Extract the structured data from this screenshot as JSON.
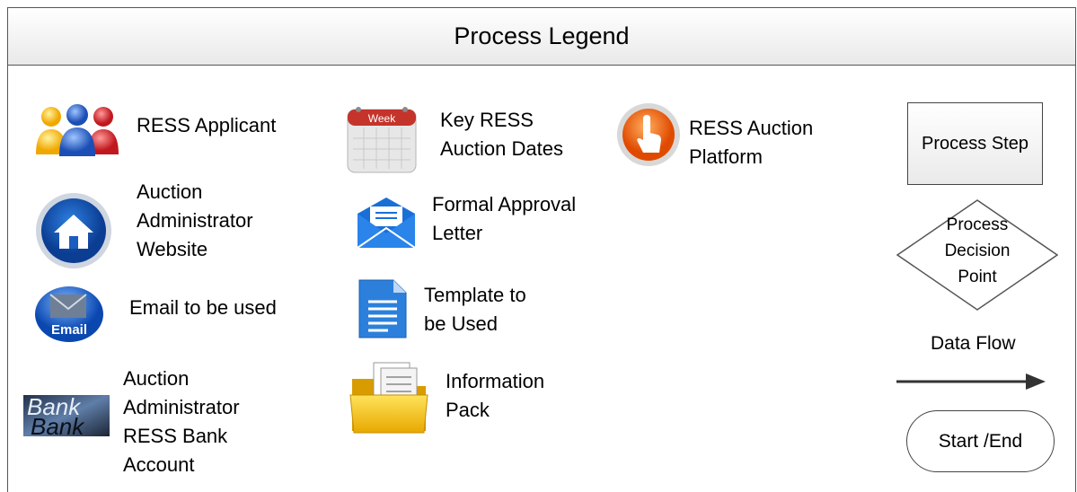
{
  "header": {
    "title": "Process Legend"
  },
  "items": {
    "applicant": "RESS Applicant",
    "website": [
      "Auction",
      "Administrator",
      "Website"
    ],
    "email": "Email to be used",
    "bank": [
      "Auction",
      "Administrator",
      "RESS Bank",
      "Account"
    ],
    "bank_icon_text": [
      "Bank",
      "Bank"
    ],
    "dates": [
      "Key RESS",
      "Auction Dates"
    ],
    "calendar_icon_text": "Week",
    "approval": [
      "Formal Approval",
      "Letter"
    ],
    "template": [
      "Template to",
      "be Used"
    ],
    "pack": [
      "Information",
      "Pack"
    ],
    "platform": [
      "RESS Auction",
      "Platform"
    ],
    "email_icon_text": "Email"
  },
  "shapes": {
    "process_step": "Process Step",
    "decision": [
      "Process",
      "Decision",
      "Point"
    ],
    "data_flow": "Data Flow",
    "start_end": "Start /End"
  }
}
